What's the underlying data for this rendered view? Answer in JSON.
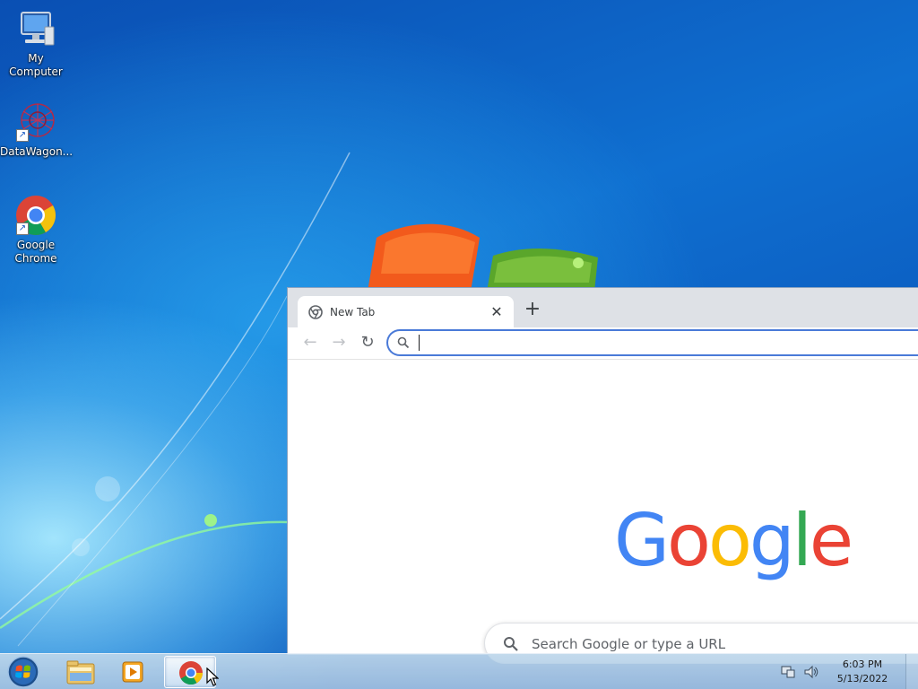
{
  "desktop": {
    "icons": [
      {
        "label": "My Computer",
        "icon": "computer-icon"
      },
      {
        "label": "DataWagon...",
        "icon": "datawagon-icon"
      },
      {
        "label": "Google Chrome",
        "icon": "chrome-icon"
      }
    ]
  },
  "browser": {
    "tab": {
      "title": "New Tab",
      "close_glyph": "✕"
    },
    "new_tab_glyph": "+",
    "toolbar": {
      "back_glyph": "←",
      "forward_glyph": "→",
      "reload_glyph": "↻",
      "omnibox_value": ""
    },
    "content": {
      "logo_letters": [
        "G",
        "o",
        "o",
        "g",
        "l",
        "e"
      ],
      "logo_colors": [
        "#4285F4",
        "#EA4335",
        "#FBBC05",
        "#4285F4",
        "#34A853",
        "#EA4335"
      ],
      "search_placeholder": "Search Google or type a URL"
    }
  },
  "taskbar": {
    "apps": [
      "start-orb-icon",
      "file-explorer-icon",
      "media-player-icon",
      "chrome-icon"
    ],
    "clock": {
      "time": "6:03 PM",
      "date": "5/13/2022"
    }
  },
  "colors": {
    "accent": "#4a7ad8",
    "tabstrip": "#dee1e6"
  }
}
